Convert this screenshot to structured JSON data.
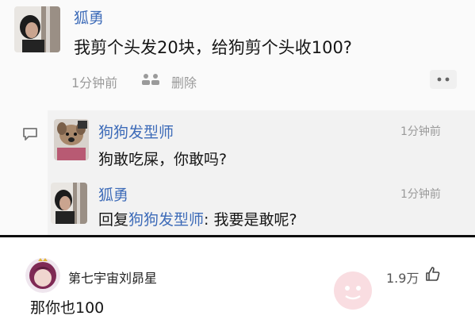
{
  "post": {
    "author": "狐勇",
    "text": "我剪个头发20块，给狗剪个头收100?",
    "time": "1分钟前",
    "delete_label": "删除",
    "more_icon": "more-dots-icon",
    "people_icon": "people-icon"
  },
  "replies": [
    {
      "author": "狗狗发型师",
      "time": "1分钟前",
      "text": "狗敢吃屎，你敢吗?"
    },
    {
      "author": "狐勇",
      "time": "1分钟前",
      "reply_prefix": "回复",
      "reply_to": "狗狗发型师",
      "reply_text": ": 我要是敢呢?"
    }
  ],
  "comment": {
    "author": "第七宇宙刘昴星",
    "likes": "1.9万",
    "text": "那你也100",
    "like_icon": "thumbs-up-icon"
  },
  "colors": {
    "link": "#3d6bb8",
    "gray": "#9a9a9a",
    "divider": "#0d0d0d"
  }
}
